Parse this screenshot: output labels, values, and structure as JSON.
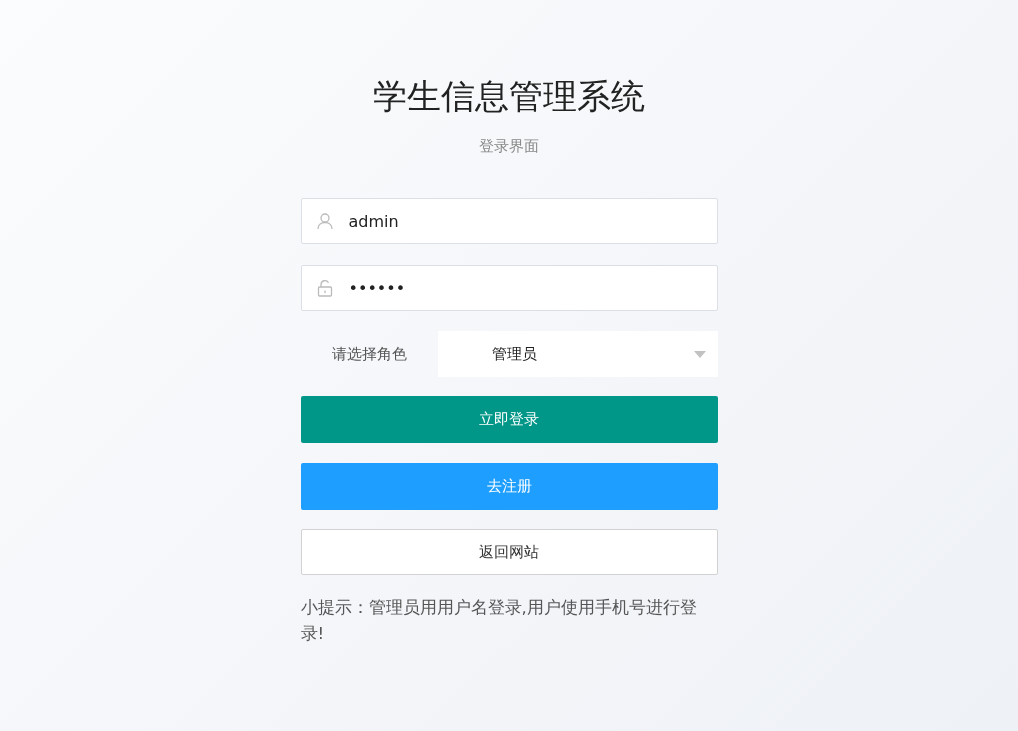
{
  "title": "学生信息管理系统",
  "subtitle": "登录界面",
  "username": {
    "value": "admin"
  },
  "password": {
    "value": "••••••"
  },
  "role": {
    "label": "请选择角色",
    "value": "管理员"
  },
  "buttons": [
    {
      "label": "立即登录",
      "kind": "primary"
    },
    {
      "label": "去注册",
      "kind": "secondary"
    },
    {
      "label": "返回网站",
      "kind": "plain"
    }
  ],
  "hint": "小提示：管理员用用户名登录,用户使用手机号进行登录!"
}
